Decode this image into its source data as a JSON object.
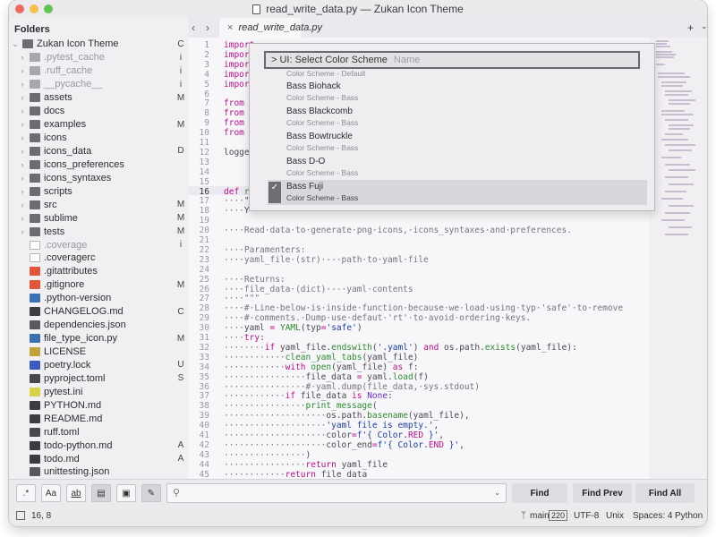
{
  "window": {
    "title": "read_write_data.py — Zukan Icon Theme"
  },
  "colors": {
    "close": "#ed6b5f",
    "minimize": "#f5bf4f",
    "zoom": "#61c554",
    "keyword": "#b0128a",
    "function": "#2e8a32",
    "string": "#1c3f98",
    "comment": "#77757c"
  },
  "sidebar": {
    "header": "Folders",
    "root": {
      "label": "Zukan Icon Theme",
      "badge": "C"
    },
    "items": [
      {
        "label": ".pytest_cache",
        "badge": "i",
        "type": "folder",
        "dim": true,
        "chev": true
      },
      {
        "label": ".ruff_cache",
        "badge": "i",
        "type": "folder",
        "dim": true,
        "chev": true
      },
      {
        "label": "__pycache__",
        "badge": "i",
        "type": "folder",
        "dim": true,
        "chev": true
      },
      {
        "label": "assets",
        "badge": "M",
        "type": "folder",
        "dim": false,
        "chev": true
      },
      {
        "label": "docs",
        "badge": "",
        "type": "folder",
        "dim": false,
        "chev": true
      },
      {
        "label": "examples",
        "badge": "M",
        "type": "folder",
        "dim": false,
        "chev": true
      },
      {
        "label": "icons",
        "badge": "",
        "type": "folder",
        "dim": false,
        "chev": true
      },
      {
        "label": "icons_data",
        "badge": "D",
        "type": "folder",
        "dim": false,
        "chev": true
      },
      {
        "label": "icons_preferences",
        "badge": "",
        "type": "folder",
        "dim": false,
        "chev": true
      },
      {
        "label": "icons_syntaxes",
        "badge": "",
        "type": "folder",
        "dim": false,
        "chev": true
      },
      {
        "label": "scripts",
        "badge": "",
        "type": "folder",
        "dim": false,
        "chev": true
      },
      {
        "label": "src",
        "badge": "M",
        "type": "folder",
        "dim": false,
        "chev": true
      },
      {
        "label": "sublime",
        "badge": "M",
        "type": "folder",
        "dim": false,
        "chev": true
      },
      {
        "label": "tests",
        "badge": "M",
        "type": "folder",
        "dim": false,
        "chev": true
      },
      {
        "label": ".coverage",
        "badge": "i",
        "type": "file",
        "dim": true,
        "chev": false
      },
      {
        "label": ".coveragerc",
        "badge": "",
        "type": "file",
        "dim": false,
        "chev": false
      },
      {
        "label": ".gitattributes",
        "badge": "",
        "type": "git",
        "dim": false,
        "chev": false
      },
      {
        "label": ".gitignore",
        "badge": "M",
        "type": "git",
        "dim": false,
        "chev": false
      },
      {
        "label": ".python-version",
        "badge": "",
        "type": "python",
        "dim": false,
        "chev": false
      },
      {
        "label": "CHANGELOG.md",
        "badge": "C",
        "type": "md",
        "dim": false,
        "chev": false
      },
      {
        "label": "dependencies.json",
        "badge": "",
        "type": "json",
        "dim": false,
        "chev": false
      },
      {
        "label": "file_type_icon.py",
        "badge": "M",
        "type": "py",
        "dim": false,
        "chev": false
      },
      {
        "label": "LICENSE",
        "badge": "",
        "type": "license",
        "dim": false,
        "chev": false
      },
      {
        "label": "poetry.lock",
        "badge": "U",
        "type": "poetry",
        "dim": false,
        "chev": false
      },
      {
        "label": "pyproject.toml",
        "badge": "S",
        "type": "toml",
        "dim": false,
        "chev": false
      },
      {
        "label": "pytest.ini",
        "badge": "",
        "type": "ini",
        "dim": false,
        "chev": false
      },
      {
        "label": "PYTHON.md",
        "badge": "",
        "type": "md",
        "dim": false,
        "chev": false
      },
      {
        "label": "README.md",
        "badge": "",
        "type": "md",
        "dim": false,
        "chev": false
      },
      {
        "label": "ruff.toml",
        "badge": "",
        "type": "toml",
        "dim": false,
        "chev": false
      },
      {
        "label": "todo-python.md",
        "badge": "A",
        "type": "md",
        "dim": false,
        "chev": false
      },
      {
        "label": "todo.md",
        "badge": "A",
        "type": "md",
        "dim": false,
        "chev": false
      },
      {
        "label": "unittesting.json",
        "badge": "",
        "type": "json",
        "dim": false,
        "chev": false
      }
    ]
  },
  "tabs": [
    {
      "label": "read_write_data.py"
    }
  ],
  "editor": {
    "lines": [
      {
        "n": "1",
        "html": "<span class='kw'>import</span> <span class='cm'>...</span>"
      },
      {
        "n": "2",
        "html": "<span class='kw'>impor</span>"
      },
      {
        "n": "3",
        "html": "<span class='kw'>impor</span>"
      },
      {
        "n": "4",
        "html": "<span class='kw'>impor</span>"
      },
      {
        "n": "5",
        "html": "<span class='kw'>impor</span>"
      },
      {
        "n": "6",
        "html": ""
      },
      {
        "n": "7",
        "html": "<span class='kw'>from</span>"
      },
      {
        "n": "8",
        "html": "<span class='kw'>from</span>"
      },
      {
        "n": "9",
        "html": "<span class='kw'>from</span>"
      },
      {
        "n": "10",
        "html": "<span class='kw'>from</span>"
      },
      {
        "n": "11",
        "html": ""
      },
      {
        "n": "12",
        "html": "logge"
      },
      {
        "n": "13",
        "html": ""
      },
      {
        "n": "14",
        "html": ""
      },
      {
        "n": "15",
        "html": ""
      },
      {
        "n": "16",
        "html": "<span class='kw'>def</span> <span class='fn'>r</span>"
      },
      {
        "n": "17",
        "html": "<span class='cm'>····</span>\"\"\""
      },
      {
        "n": "18",
        "html": "<span class='cm'>····</span>Y"
      },
      {
        "n": "19",
        "html": ""
      },
      {
        "n": "20",
        "html": "<span class='cm'>····Read·data·to·generate·png·icons,·icons_syntaxes·and·preferences.</span>"
      },
      {
        "n": "21",
        "html": ""
      },
      {
        "n": "22",
        "html": "<span class='cm'>····Paramenters:</span>"
      },
      {
        "n": "23",
        "html": "<span class='cm'>····yaml_file·(str)·--·path·to·yaml·file</span>"
      },
      {
        "n": "24",
        "html": ""
      },
      {
        "n": "25",
        "html": "<span class='cm'>····Returns:</span>"
      },
      {
        "n": "26",
        "html": "<span class='cm'>····file_data·(dict)·--·yaml·contents</span>"
      },
      {
        "n": "27",
        "html": "<span class='cm'>····\"\"\"</span>"
      },
      {
        "n": "28",
        "html": "<span class='cm'>····#·Line·below·is·inside·function·because·we·load·using·typ·'safe'·to·remove</span>"
      },
      {
        "n": "29",
        "html": "<span class='cm'>····#·comments.·Dump·use·defaut·'rt'·to·avoid·ordering·keys.</span>"
      },
      {
        "n": "30",
        "html": "<span class='cm'>····</span>yaml <span class='kw'>=</span> <span class='fn'>YAML</span>(typ<span class='kw'>=</span><span class='st'>'safe'</span>)"
      },
      {
        "n": "31",
        "html": "<span class='cm'>····</span><span class='kw'>try</span>:"
      },
      {
        "n": "32",
        "html": "<span class='cm'>········</span><span class='kw'>if</span> yaml_file.<span class='fn'>endswith</span>(<span class='st'>'.yaml'</span>) <span class='kw'>and</span> os.path.<span class='fn'>exists</span>(yaml_file):"
      },
      {
        "n": "33",
        "html": "<span class='cm'>············</span><span class='fn'>clean_yaml_tabs</span>(yaml_file)"
      },
      {
        "n": "34",
        "html": "<span class='cm'>············</span><span class='kw'>with</span> <span class='fn'>open</span>(yaml_file) <span class='kw'>as</span> f:"
      },
      {
        "n": "35",
        "html": "<span class='cm'>················</span>file_data <span class='kw'>=</span> yaml.<span class='fn'>load</span>(f)"
      },
      {
        "n": "36",
        "html": "<span class='cm'>················#·yaml.dump(file_data,·sys.stdout)</span>"
      },
      {
        "n": "37",
        "html": "<span class='cm'>············</span><span class='kw'>if</span> file_data <span class='kw'>is</span> <span class='it'>None</span>:"
      },
      {
        "n": "38",
        "html": "<span class='cm'>················</span><span class='fn'>print_message</span>("
      },
      {
        "n": "39",
        "html": "<span class='cm'>····················</span>os.path.<span class='fn'>basename</span>(yaml_file),"
      },
      {
        "n": "40",
        "html": "<span class='cm'>····················</span><span class='st'>'yaml file is empty.'</span>,"
      },
      {
        "n": "41",
        "html": "<span class='cm'>····················</span>color<span class='kw'>=</span><span class='st'>f'{ Color.<span class='kw'>RED</span> }'</span>,"
      },
      {
        "n": "42",
        "html": "<span class='cm'>····················</span>color_end<span class='kw'>=</span><span class='st'>f'{ Color.<span class='kw'>END</span> }'</span>,"
      },
      {
        "n": "43",
        "html": "<span class='cm'>················</span>)"
      },
      {
        "n": "44",
        "html": "<span class='cm'>················</span><span class='kw'>return</span> yaml_file"
      },
      {
        "n": "45",
        "html": "<span class='cm'>············</span><span class='kw'>return</span> file_data"
      }
    ],
    "current_line": "16"
  },
  "palette": {
    "prompt": "> UI: Select Color Scheme",
    "placeholder": "Name",
    "top_partial": "Color Scheme - Default",
    "items": [
      {
        "name": "Bass Biohack",
        "sub": "Color Scheme - Bass",
        "selected": false
      },
      {
        "name": "Bass Blackcomb",
        "sub": "Color Scheme - Bass",
        "selected": false
      },
      {
        "name": "Bass Bowtruckle",
        "sub": "Color Scheme - Bass",
        "selected": false
      },
      {
        "name": "Bass D-O",
        "sub": "Color Scheme - Bass",
        "selected": false
      },
      {
        "name": "Bass Fuji",
        "sub": "Color Scheme - Bass",
        "selected": true
      }
    ]
  },
  "findbar": {
    "find": "Find",
    "find_prev": "Find Prev",
    "find_all": "Find All",
    "opt_regex": ".*",
    "opt_case": "Aa",
    "opt_word": "ab"
  },
  "status": {
    "position": "16, 8",
    "branch": "main",
    "branch_count": "220",
    "encoding": "UTF-8",
    "line_endings": "Unix",
    "indent": "Spaces: 4",
    "syntax": "Python"
  }
}
